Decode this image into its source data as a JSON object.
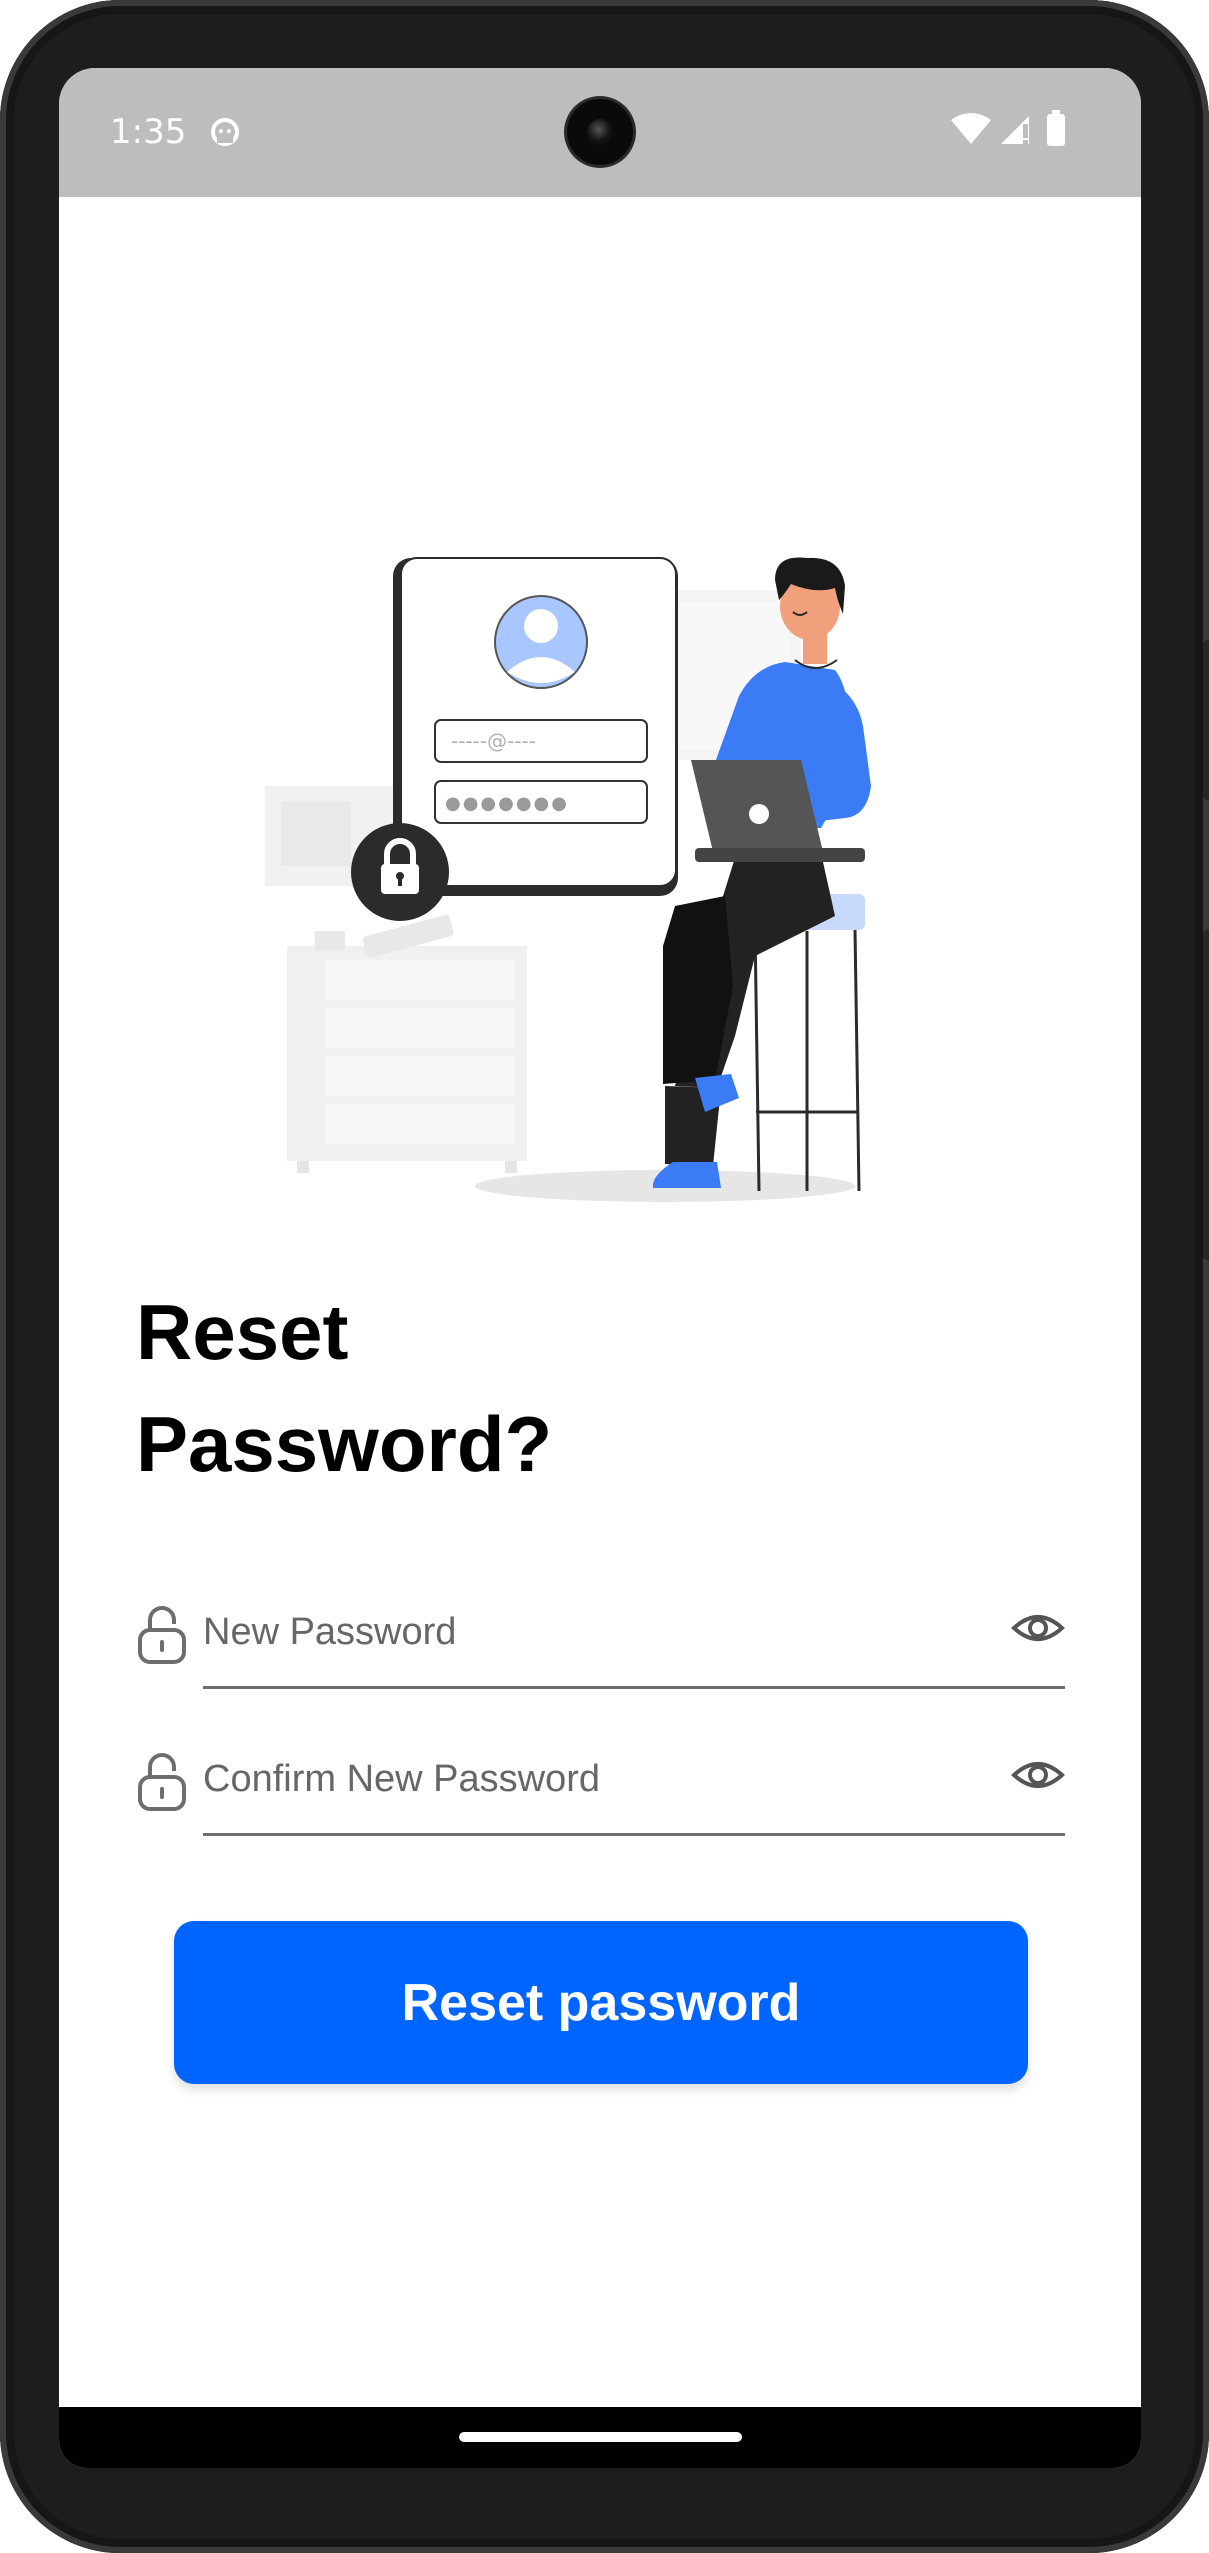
{
  "status_bar": {
    "time": "1:35",
    "notification_icon": "android-head-icon",
    "icons": [
      "wifi-icon",
      "signal-icon",
      "battery-icon"
    ],
    "background_color": "#bdbdbd"
  },
  "illustration": {
    "description_icon": "login-security-illustration",
    "email_placeholder": "-----@----",
    "password_placeholder": "●●●●●●●"
  },
  "page": {
    "title_line1": "Reset",
    "title_line2": "Password?"
  },
  "form": {
    "new_password": {
      "placeholder": "New Password",
      "value": "",
      "lead_icon": "unlock-icon",
      "trail_icon": "eye-icon"
    },
    "confirm_password": {
      "placeholder": "Confirm New Password",
      "value": "",
      "lead_icon": "unlock-icon",
      "trail_icon": "eye-icon"
    },
    "submit_label": "Reset password"
  },
  "colors": {
    "accent": "#0064ff",
    "figure_blue": "#3b7cf6",
    "text": "#000000"
  }
}
